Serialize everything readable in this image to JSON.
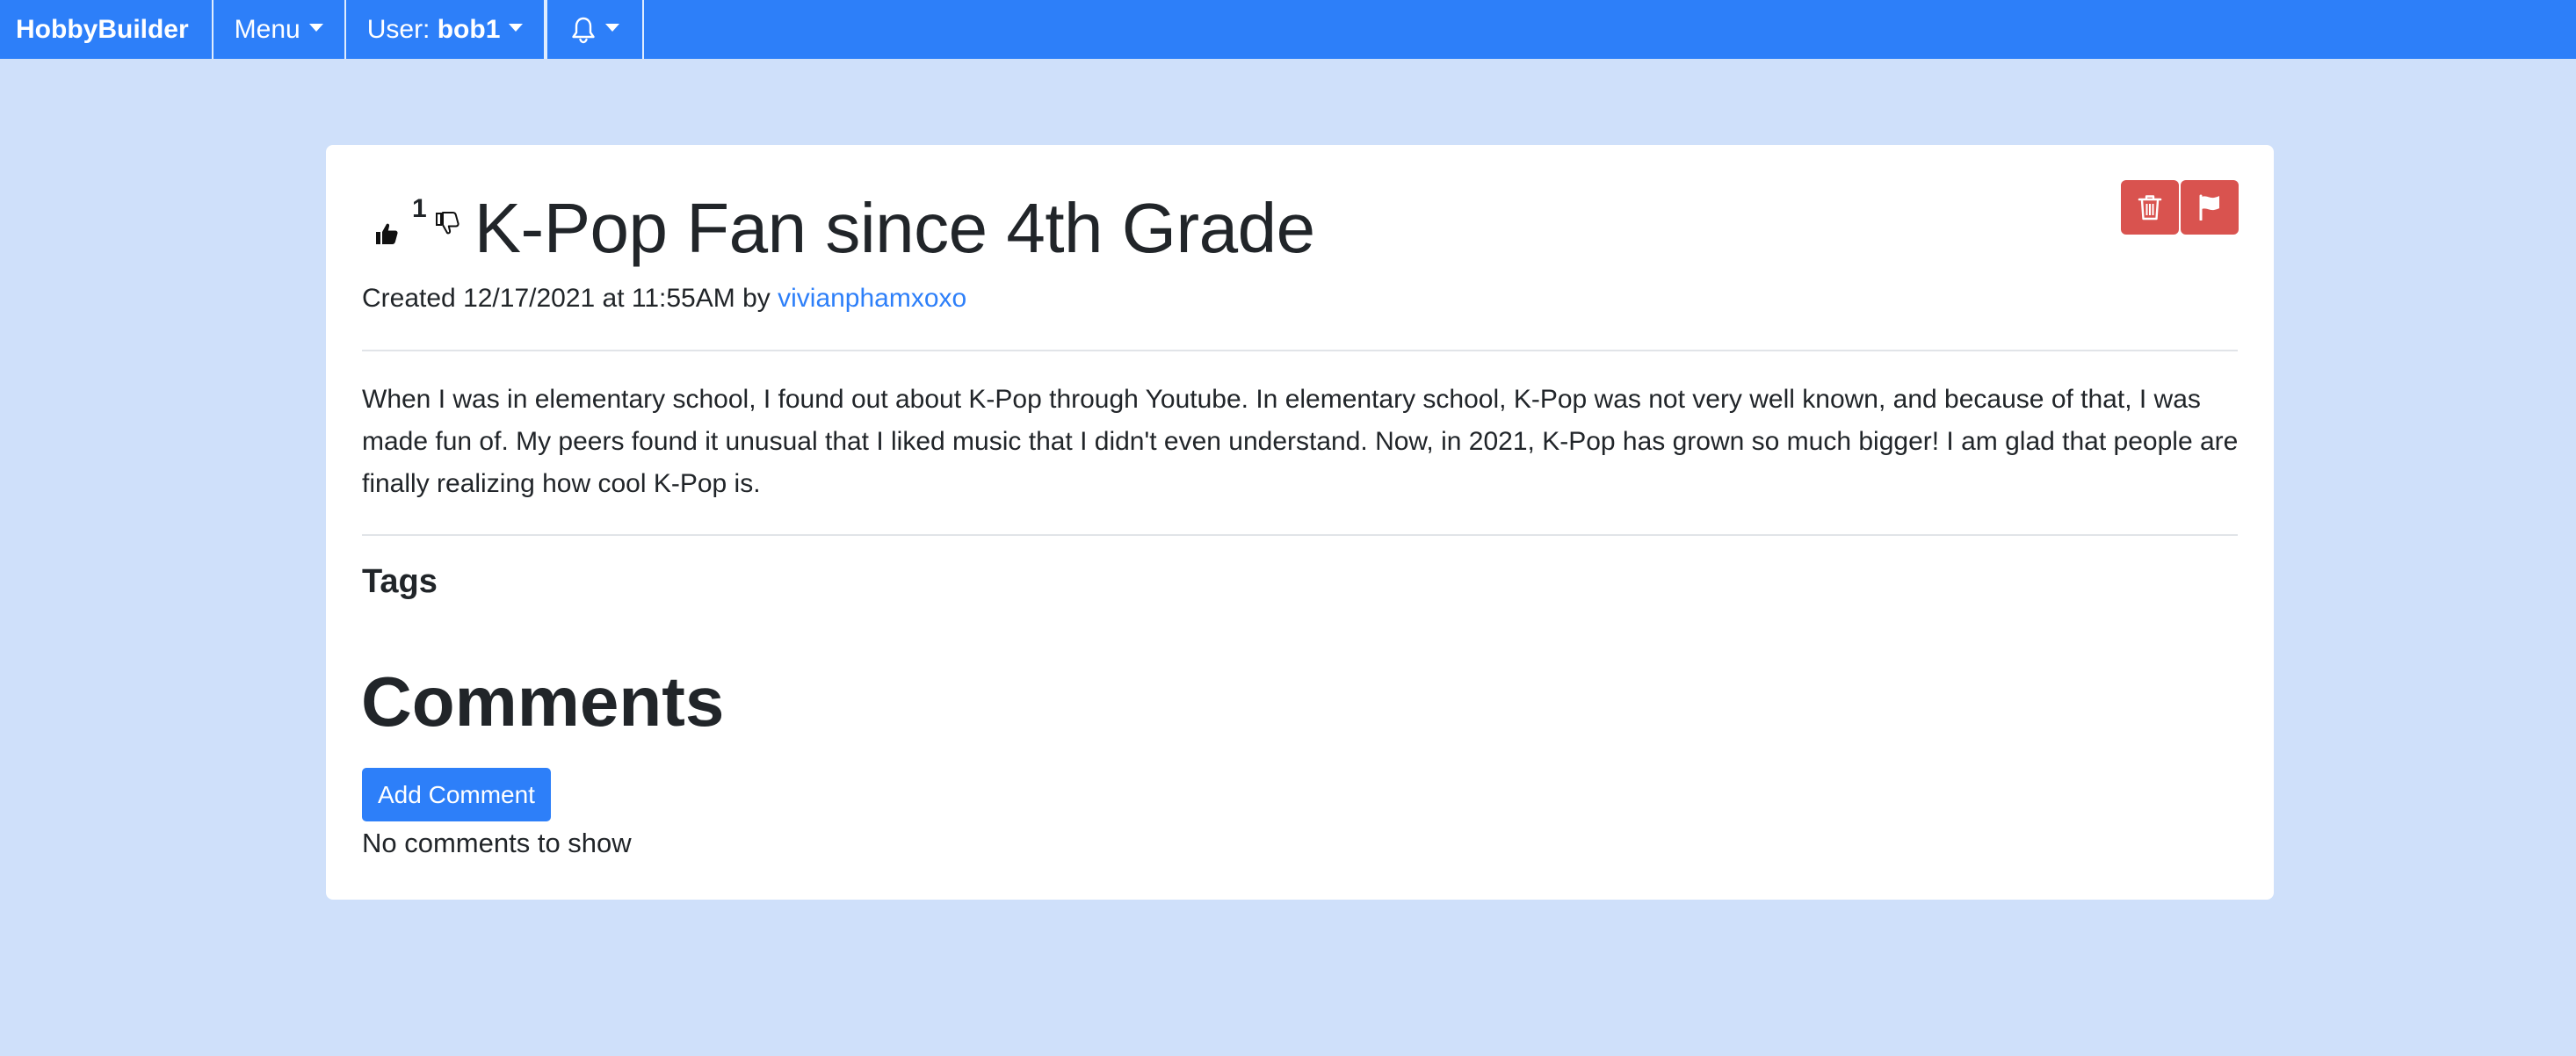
{
  "navbar": {
    "brand": "HobbyBuilder",
    "menu_label": "Menu",
    "user_prefix": "User: ",
    "username": "bob1",
    "bell_icon": "bell-icon"
  },
  "post": {
    "vote_count": "1",
    "title": "K-Pop Fan since 4th Grade",
    "created_prefix": "Created 12/17/2021 at 11:55AM by ",
    "author": "vivianphamxoxo",
    "body": "When I was in elementary school, I found out about K-Pop through Youtube. In elementary school, K-Pop was not very well known, and because of that, I was made fun of. My peers found it unusual that I liked music that I didn't even understand. Now, in 2021, K-Pop has grown so much bigger! I am glad that people are finally realizing how cool K-Pop is.",
    "tags_heading": "Tags"
  },
  "comments": {
    "heading": "Comments",
    "add_button": "Add Comment",
    "empty_text": "No comments to show"
  },
  "colors": {
    "navbar": "#2d7ff9",
    "page_background": "#cfe0fa",
    "danger": "#d9534f",
    "link": "#2d7ff9"
  }
}
